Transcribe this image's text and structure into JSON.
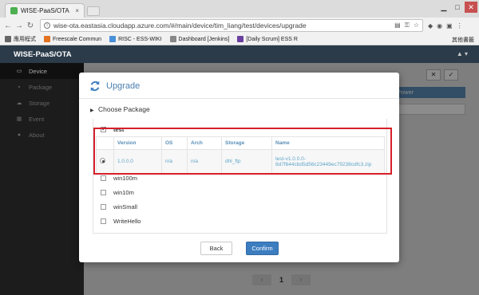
{
  "browser": {
    "tab_title": "WISE-PaaS/OTA",
    "tab_close": "×",
    "window_controls": [
      "▁",
      "□",
      "✕"
    ],
    "url": "wise-ota.eastasia.cloudapp.azure.com/#/main/device/tim_liang/test/devices/upgrade",
    "bookmarks": [
      {
        "label": "應用程式",
        "icon": "apps-grid-icon",
        "color": "#666666"
      },
      {
        "label": "Freescale Commun",
        "icon": "freescale-icon",
        "color": "#e37222"
      },
      {
        "label": "RISC - ESS-WIKI",
        "icon": "wiki-icon",
        "color": "#4a90d9"
      },
      {
        "label": "Dashboard [Jenkins]",
        "icon": "jenkins-icon",
        "color": "#888888"
      },
      {
        "label": "[Daily Scrum] ESS R",
        "icon": "scrum-icon",
        "color": "#6b3fa0"
      }
    ],
    "other_bookmarks": "其他書籤"
  },
  "app": {
    "brand": "WISE-PaaS/OTA",
    "user_menu": "▲ ▾",
    "sidebar": [
      {
        "label": "Device",
        "icon": "monitor-icon",
        "glyph": "▭",
        "active": true
      },
      {
        "label": "Package",
        "icon": "package-icon",
        "glyph": "▪",
        "active": false
      },
      {
        "label": "Storage",
        "icon": "cloud-icon",
        "glyph": "☁",
        "active": false
      },
      {
        "label": "Event",
        "icon": "calendar-icon",
        "glyph": "▦",
        "active": false
      },
      {
        "label": "About",
        "icon": "info-icon",
        "glyph": "●",
        "active": false
      }
    ],
    "background": {
      "power_label": "Power",
      "close_btn": "✕",
      "check_btn": "✓",
      "page_number": "1",
      "prev": "‹",
      "next": "›"
    }
  },
  "modal": {
    "title": "Upgrade",
    "section_label": "Choose Package",
    "packages": [
      {
        "name": "test",
        "checked": true,
        "bold": true
      },
      {
        "name": "win100m",
        "checked": false,
        "bold": false
      },
      {
        "name": "win10m",
        "checked": false,
        "bold": false
      },
      {
        "name": "winSmall",
        "checked": false,
        "bold": false
      },
      {
        "name": "WriteHello",
        "checked": false,
        "bold": false
      }
    ],
    "version_table": {
      "headers": [
        "",
        "Version",
        "OS",
        "Arch",
        "Storage",
        "Name"
      ],
      "rows": [
        {
          "version": "1.0.0.0",
          "os": "n/a",
          "arch": "n/a",
          "storage": "dhl_ftp",
          "name": "test-v1.0.0.0-8d7f644cbd5d56c23449ec79238cdfc3.zip",
          "selected": true
        }
      ]
    },
    "back_label": "Back",
    "confirm_label": "Confirm"
  },
  "colors": {
    "accent": "#3c7dc0",
    "title_blue": "#4a7fb0",
    "highlight_red": "#d6202a",
    "sidebar_bg": "#2b2b2b",
    "topbar_bg": "#2b3b4a"
  }
}
